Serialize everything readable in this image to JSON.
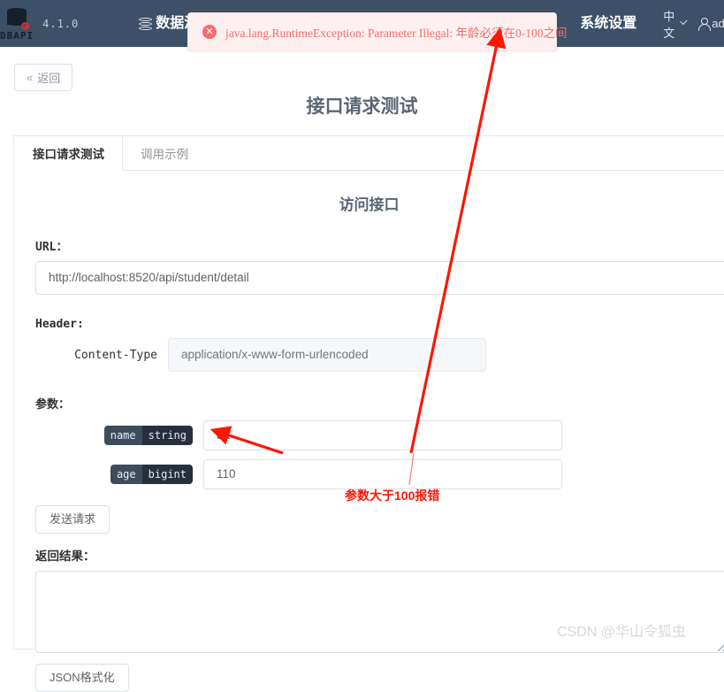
{
  "navbar": {
    "logo_text": "DBAPI",
    "version": "4.1.0",
    "items": [
      {
        "label": "数据源",
        "icon": "database-icon"
      },
      {
        "label": "系统设置",
        "icon": ""
      }
    ],
    "language": "中文",
    "user": "adm"
  },
  "toast": {
    "icon": "error-circle-icon",
    "symbol": "✕",
    "message": "java.lang.RuntimeException: Parameter Illegal: 年龄必须在0-100之间",
    "bg_color": "#fef0f0",
    "text_color": "#f56c6c"
  },
  "back_button": {
    "label": "返回",
    "chevron": "«"
  },
  "page_title": "接口请求测试",
  "tabs": [
    {
      "label": "接口请求测试",
      "active": true
    },
    {
      "label": "调用示例",
      "active": false
    }
  ],
  "form": {
    "sub_title": "访问接口",
    "url_label": "URL：",
    "url_value": "http://localhost:8520/api/student/detail",
    "header_label": "Header:",
    "header_rows": [
      {
        "key": "Content-Type",
        "placeholder": "application/x-www-form-urlencoded",
        "value": ""
      }
    ],
    "params_label": "参数：",
    "params": [
      {
        "name": "name",
        "type": "string",
        "value": "aa"
      },
      {
        "name": "age",
        "type": "bigint",
        "value": "110"
      }
    ],
    "send_button": "发送请求",
    "result_label": "返回结果：",
    "result_value": "",
    "json_button": "JSON格式化"
  },
  "annotations": {
    "note": "参数大于100报错",
    "color": "#fc1705"
  },
  "watermark": "CSDN @华山令狐虫"
}
